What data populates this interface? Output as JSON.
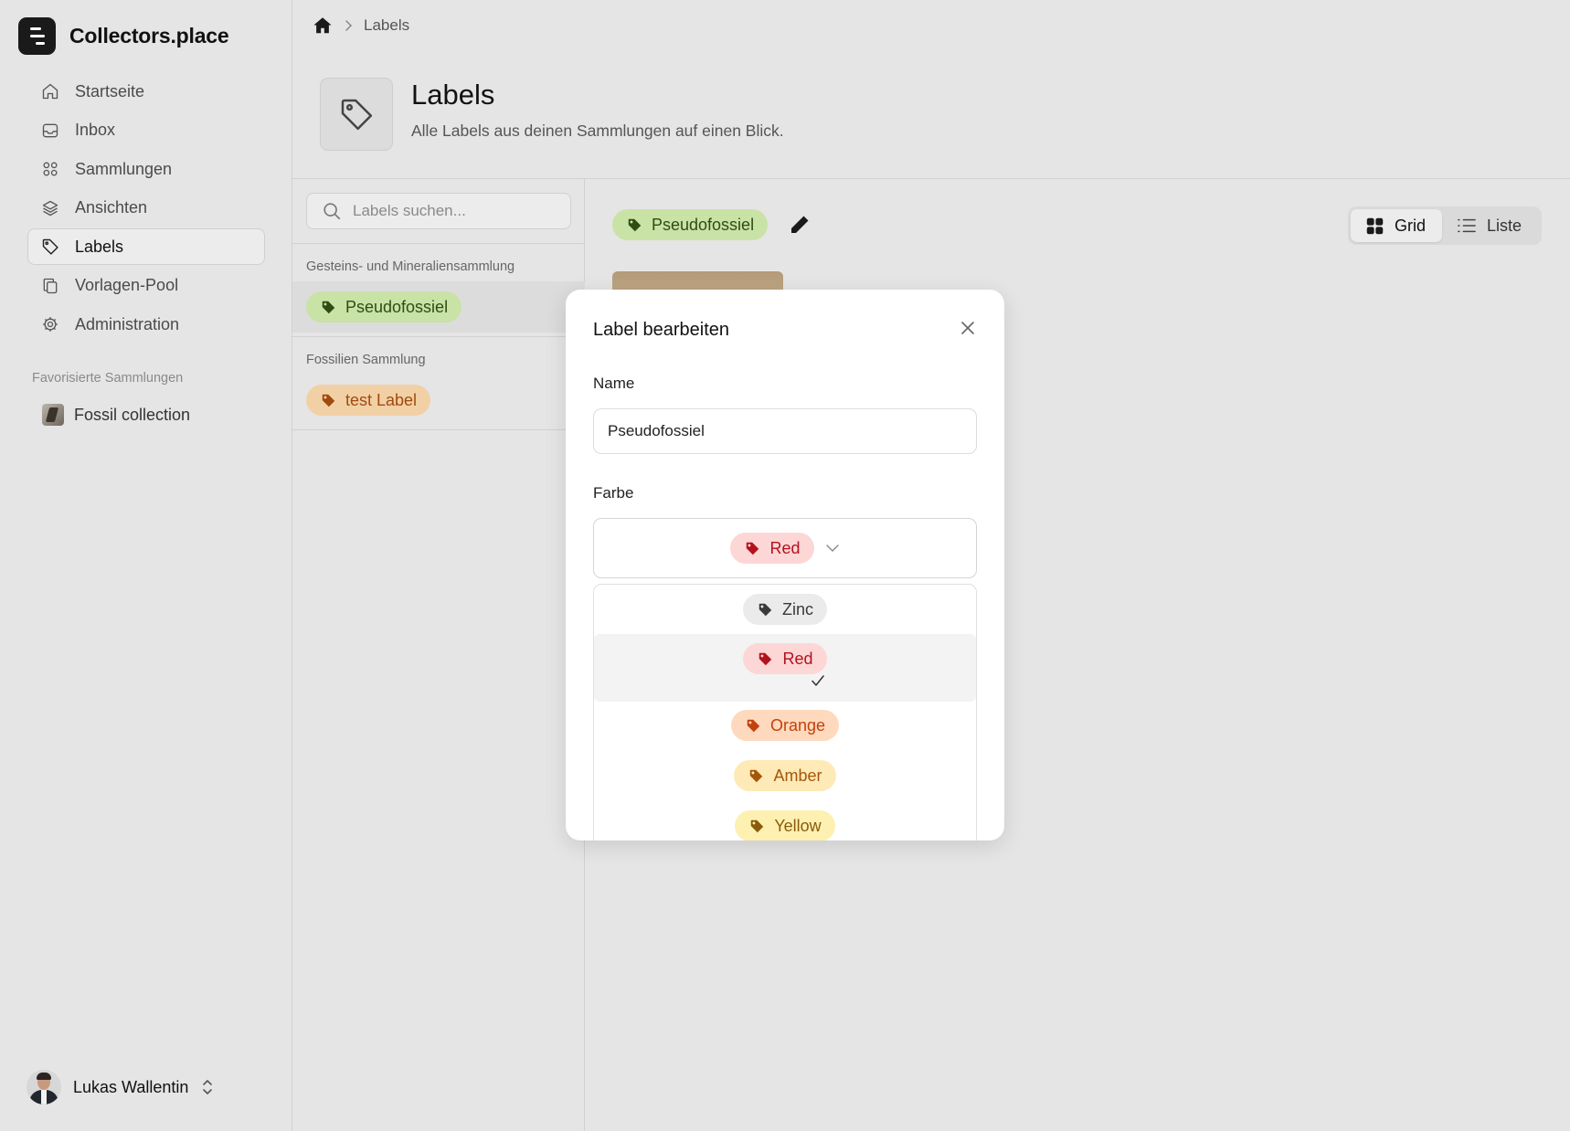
{
  "app": {
    "name": "Collectors.place"
  },
  "sidebar": {
    "items": [
      {
        "label": "Startseite",
        "icon": "home-icon"
      },
      {
        "label": "Inbox",
        "icon": "inbox-icon"
      },
      {
        "label": "Sammlungen",
        "icon": "grid-icon"
      },
      {
        "label": "Ansichten",
        "icon": "layers-icon"
      },
      {
        "label": "Labels",
        "icon": "tag-icon",
        "active": true
      },
      {
        "label": "Vorlagen-Pool",
        "icon": "copy-icon"
      },
      {
        "label": "Administration",
        "icon": "gear-icon"
      }
    ],
    "favorites_title": "Favorisierte Sammlungen",
    "favorites": [
      {
        "label": "Fossil collection"
      }
    ],
    "user": {
      "name": "Lukas Wallentin"
    }
  },
  "breadcrumb": {
    "current": "Labels"
  },
  "page": {
    "title": "Labels",
    "subtitle": "Alle Labels aus deinen Sammlungen auf einen Blick."
  },
  "labels_panel": {
    "search_placeholder": "Labels suchen...",
    "groups": [
      {
        "title": "Gesteins- und Mineraliensammlung",
        "labels": [
          {
            "name": "Pseudofossiel",
            "color": "#c9e2a6"
          }
        ]
      },
      {
        "title": "Fossilien Sammlung",
        "labels": [
          {
            "name": "test Label",
            "color": "#f2d0a6"
          }
        ]
      }
    ]
  },
  "content": {
    "selected_label": "Pseudofossiel",
    "view_toggle": {
      "grid": "Grid",
      "list": "Liste",
      "active": "grid"
    }
  },
  "modal": {
    "title": "Label bearbeiten",
    "name_label": "Name",
    "name_value": "Pseudofossiel",
    "color_label": "Farbe",
    "selected_color": "Red",
    "options": [
      {
        "label": "Zinc",
        "color": "#ebebeb"
      },
      {
        "label": "Red",
        "color": "#fdd6d6",
        "selected": true
      },
      {
        "label": "Orange",
        "color": "#ffd9bd"
      },
      {
        "label": "Amber",
        "color": "#feeab6"
      },
      {
        "label": "Yellow",
        "color": "#fdf0b0"
      }
    ]
  }
}
